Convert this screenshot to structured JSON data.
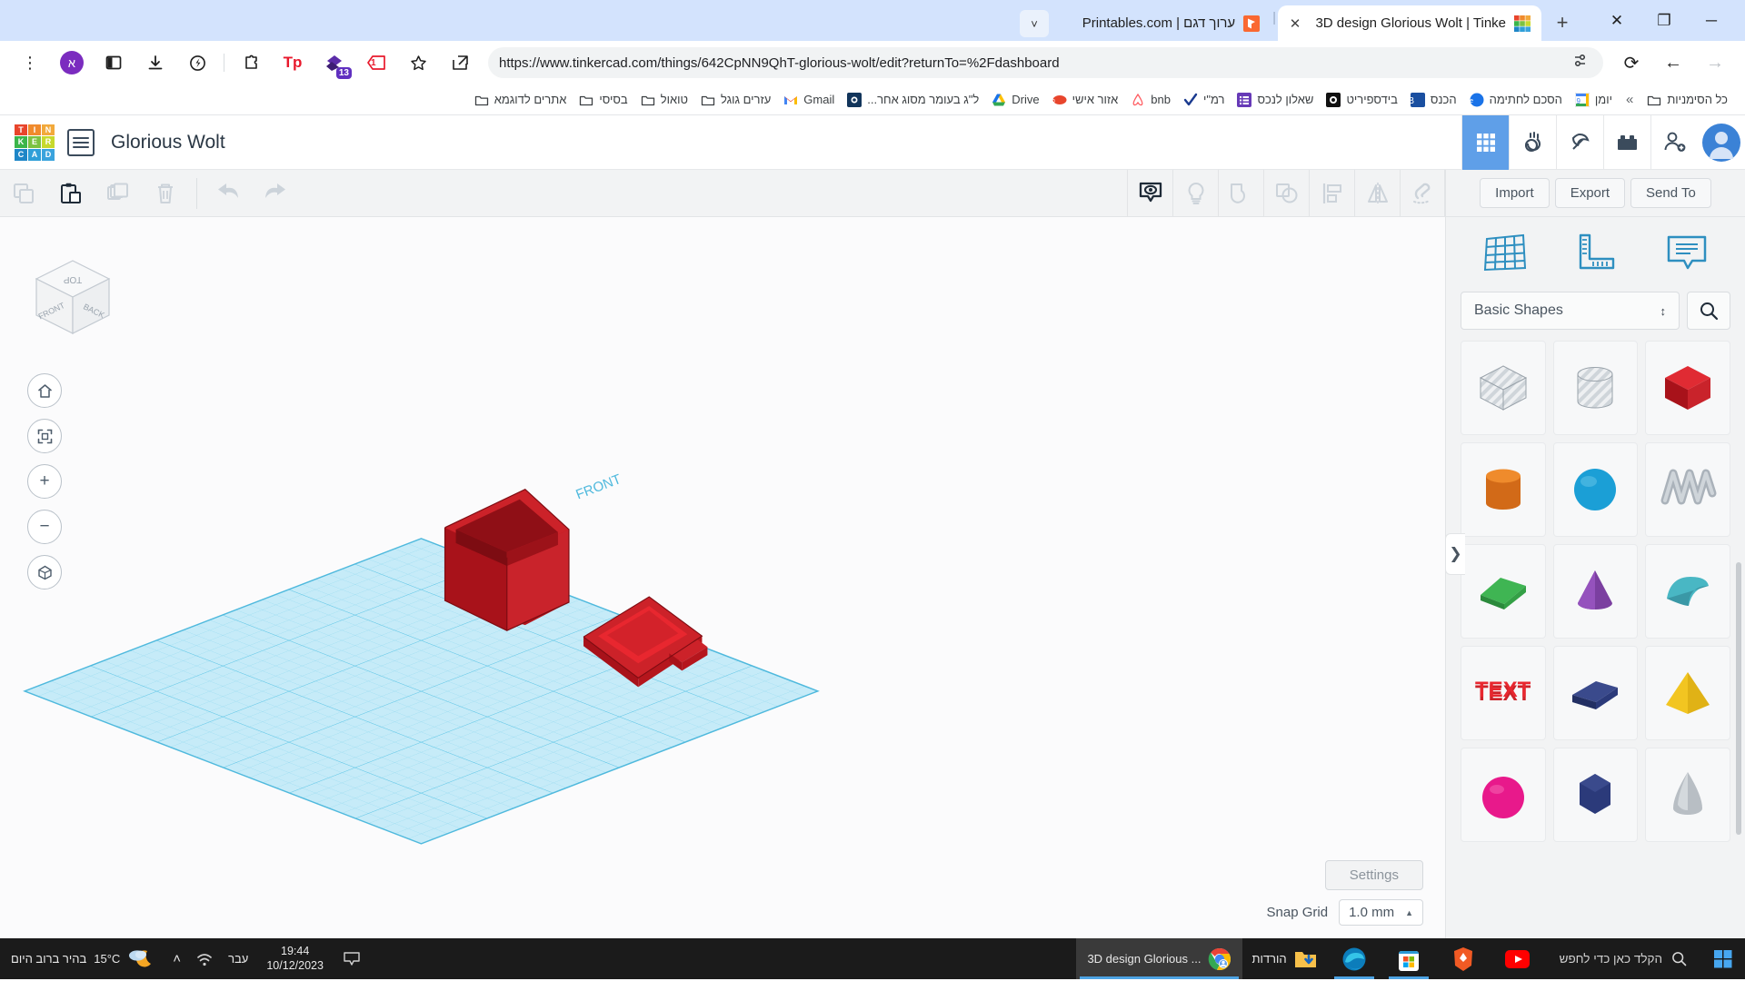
{
  "browser": {
    "window_controls": [
      {
        "name": "close",
        "glyph": "✕"
      },
      {
        "name": "restore",
        "glyph": "❐"
      },
      {
        "name": "minimize",
        "glyph": "─"
      }
    ],
    "tabs": [
      {
        "title": "3D design Glorious Wolt | Tinke",
        "favicon": "tinkercad-icon",
        "active": true,
        "close_glyph": "✕"
      },
      {
        "title": "ערוך דגם | Printables.com",
        "favicon": "printables-icon",
        "active": false,
        "close_glyph": ""
      }
    ],
    "new_tab_glyph": "+",
    "tab_list_glyph": "˅",
    "url": "https://www.tinkercad.com/things/642CpNN9QhT-glorious-wolt/edit?returnTo=%2Fdashboard",
    "nav": {
      "reload_glyph": "⟳",
      "back_glyph": "←",
      "forward_glyph": "→"
    },
    "extensions": [
      {
        "name": "chrome-menu-icon",
        "label": "⋮"
      },
      {
        "name": "profile-avatar-icon",
        "label": "א"
      },
      {
        "name": "reading-list-icon",
        "label": ""
      },
      {
        "name": "downloads-icon",
        "label": ""
      },
      {
        "name": "shield-leaf-icon",
        "label": ""
      },
      {
        "name": "extensions-puzzle-icon",
        "label": ""
      },
      {
        "name": "tp-extension-icon",
        "label": "Tp"
      },
      {
        "name": "diamond-extension-icon",
        "label": "",
        "badge": "13"
      },
      {
        "name": "tag-extension-icon",
        "label": "1"
      }
    ],
    "url_settings_glyph": "≡",
    "bookmarks_overflow_glyph": "«",
    "bookmarks": [
      {
        "label": "כל הסימניות",
        "icon": "folder-icon"
      },
      {
        "label": "יומן",
        "icon": "google-calendar-icon"
      },
      {
        "label": "הסכם לחתימה",
        "icon": "esign-icon"
      },
      {
        "label": "הכנס",
        "icon": "b-blue-icon"
      },
      {
        "label": "בידספיריט",
        "icon": "camera-icon"
      },
      {
        "label": "שאלון לנכס",
        "icon": "forms-icon"
      },
      {
        "label": "רמ\"י",
        "icon": "checkmark-icon"
      },
      {
        "label": "bnb",
        "icon": "airbnb-icon"
      },
      {
        "label": "אזור אישי",
        "icon": "red-badge-icon"
      },
      {
        "label": "Drive",
        "icon": "google-drive-icon"
      },
      {
        "label": "ל\"ג בעומר מסוג אחר...",
        "icon": "dark-blue-icon"
      },
      {
        "label": "Gmail",
        "icon": "gmail-icon"
      },
      {
        "label": "עזרים גוגל",
        "icon": "folder-icon"
      },
      {
        "label": "טואול",
        "icon": "folder-icon"
      },
      {
        "label": "בסיסי",
        "icon": "folder-icon"
      },
      {
        "label": "אתרים לדוגמא",
        "icon": "folder-icon"
      }
    ]
  },
  "tinkercad": {
    "logo_letters": [
      "T",
      "I",
      "N",
      "K",
      "E",
      "R",
      "C",
      "A",
      "D"
    ],
    "logo_colors": [
      "#e8452c",
      "#f08a2d",
      "#f2a93b",
      "#56b848",
      "#3bb54a",
      "#7cc242",
      "#1e86c7",
      "#2f9fd8",
      "#3aa3dd"
    ],
    "design_title": "Glorious Wolt",
    "header_icons": [
      {
        "name": "3d-design-icon",
        "active": true
      },
      {
        "name": "circuits-icon",
        "active": false
      },
      {
        "name": "codeblocks-pickaxe-icon",
        "active": false
      },
      {
        "name": "lego-brick-icon",
        "active": false
      },
      {
        "name": "invite-person-icon",
        "active": false
      },
      {
        "name": "user-avatar",
        "active": false
      }
    ],
    "toolbar_left": [
      {
        "name": "copy-button",
        "enabled": false
      },
      {
        "name": "paste-button",
        "enabled": true
      },
      {
        "name": "duplicate-button",
        "enabled": false
      },
      {
        "name": "delete-button",
        "enabled": false
      },
      {
        "name": "undo-button",
        "enabled": false
      },
      {
        "name": "redo-button",
        "enabled": false
      }
    ],
    "toolbar_right": [
      {
        "name": "show-hide-eye-icon",
        "enabled": true
      },
      {
        "name": "lightbulb-icon",
        "enabled": false
      },
      {
        "name": "group-icon",
        "enabled": false
      },
      {
        "name": "ungroup-icon",
        "enabled": false
      },
      {
        "name": "align-icon",
        "enabled": false
      },
      {
        "name": "mirror-icon",
        "enabled": false
      },
      {
        "name": "snap-magnet-icon",
        "enabled": false
      }
    ],
    "viewcube": {
      "top_label": "TOP",
      "front_label": "FRONT",
      "back_label": "BACK"
    },
    "nav_buttons": [
      {
        "name": "home-view-button",
        "glyph": "⌂"
      },
      {
        "name": "fit-view-button",
        "glyph": "⛶"
      },
      {
        "name": "zoom-in-button",
        "glyph": "+"
      },
      {
        "name": "zoom-out-button",
        "glyph": "−"
      },
      {
        "name": "perspective-toggle-button",
        "glyph": "⬡"
      }
    ],
    "workplane_label": "FRONT",
    "canvas_footer": {
      "settings_label": "Settings",
      "snap_grid_label": "Snap Grid",
      "snap_grid_value": "1.0 mm",
      "snap_grid_caret": "▲"
    },
    "sidebar": {
      "buttons": [
        "Import",
        "Export",
        "Send To"
      ],
      "tools": [
        {
          "name": "workplane-icon"
        },
        {
          "name": "ruler-icon"
        },
        {
          "name": "notes-icon"
        }
      ],
      "category_label": "Basic Shapes",
      "category_caret": "↕",
      "search_icon": "search-icon",
      "shapes": [
        {
          "name": "box-hole-shape",
          "kind": "box",
          "color": "#c9ced3",
          "hole": true
        },
        {
          "name": "cylinder-hole-shape",
          "kind": "cylinder",
          "color": "#c9ced3",
          "hole": true
        },
        {
          "name": "box-shape",
          "kind": "box",
          "color": "#cc2229",
          "hole": false
        },
        {
          "name": "cylinder-shape",
          "kind": "cylinder",
          "color": "#e87722",
          "hole": false
        },
        {
          "name": "sphere-shape",
          "kind": "sphere",
          "color": "#1b9fd6",
          "hole": false
        },
        {
          "name": "scribble-shape",
          "kind": "scribble",
          "color": "#9aa3ab",
          "hole": false
        },
        {
          "name": "roof-shape",
          "kind": "roof",
          "color": "#34a853",
          "hole": false
        },
        {
          "name": "cone-shape",
          "kind": "cone",
          "color": "#7b3fa0",
          "hole": false
        },
        {
          "name": "round-roof-shape",
          "kind": "roundroof",
          "color": "#3fa7b5",
          "hole": false
        },
        {
          "name": "text-shape",
          "kind": "text",
          "color": "#cc2229",
          "hole": false,
          "label": "TEXT"
        },
        {
          "name": "wedge-shape",
          "kind": "wedge",
          "color": "#2b3a7a",
          "hole": false
        },
        {
          "name": "pyramid-shape",
          "kind": "pyramid",
          "color": "#f2c521",
          "hole": false
        },
        {
          "name": "halfsphere-shape",
          "kind": "sphere",
          "color": "#e8198b",
          "hole": false
        },
        {
          "name": "polygon-shape",
          "kind": "polygon",
          "color": "#2b3a7a",
          "hole": false
        },
        {
          "name": "paraboloid-shape",
          "kind": "cone",
          "color": "#b8bec4",
          "hole": false
        }
      ],
      "collapse_handle_glyph": "❯"
    }
  },
  "taskbar": {
    "start_icon": "windows-start-icon",
    "search_placeholder": "הקלד כאן כדי לחפש",
    "search_icon": "search-icon",
    "pinned": [
      {
        "name": "youtube-taskbar-icon",
        "label": ""
      },
      {
        "name": "brave-taskbar-icon",
        "label": ""
      },
      {
        "name": "microsoft-store-taskbar-icon",
        "label": ""
      },
      {
        "name": "edge-taskbar-icon",
        "label": ""
      },
      {
        "name": "downloads-folder-taskbar-item",
        "label": "הורדות"
      }
    ],
    "active_window": {
      "label": "3D design Glorious ...",
      "icon": "chrome-icon"
    },
    "tray": {
      "show_desktop_glyph": "▭",
      "clock_time": "19:44",
      "clock_date": "10/12/2023",
      "language": "עבר",
      "wifi_icon": "wifi-icon",
      "overflow_glyph": "˄",
      "weather_temp": "15°C",
      "weather_text": "בהיר ברוב היום",
      "weather_icon": "partly-cloudy-night-icon"
    }
  }
}
